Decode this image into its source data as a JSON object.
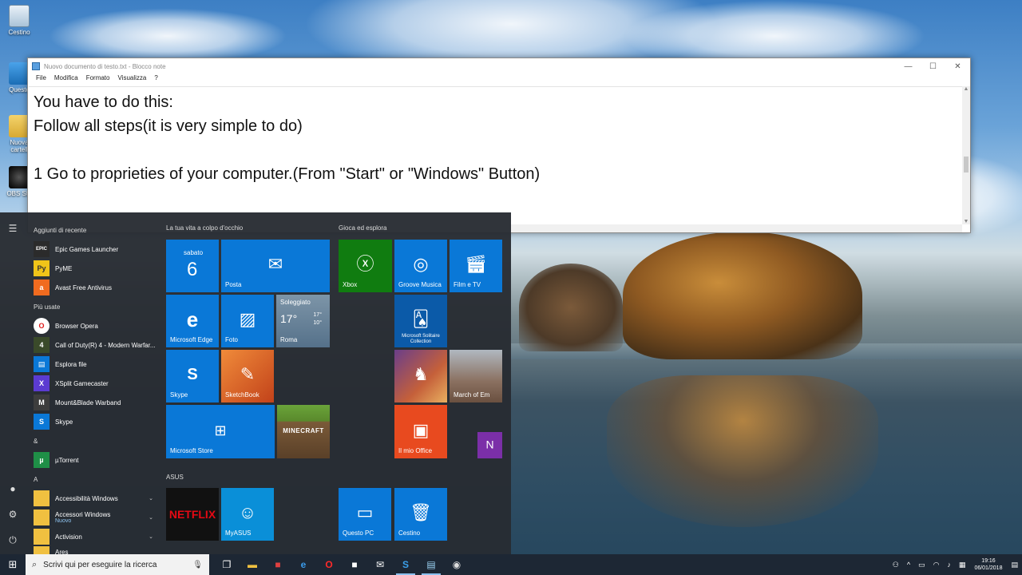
{
  "desktop": {
    "icons": [
      {
        "label": "Cestino",
        "icon": "recycle-bin-icon"
      },
      {
        "label": "Questo",
        "icon": "this-pc-icon"
      },
      {
        "label": "Nuova cartell",
        "icon": "folder-icon"
      },
      {
        "label": "OBS Stu",
        "icon": "obs-icon"
      }
    ]
  },
  "notepad": {
    "title": "Nuovo documento di testo.txt - Blocco note",
    "menu": [
      "File",
      "Modifica",
      "Formato",
      "Visualizza",
      "?"
    ],
    "controls": {
      "minimize": "—",
      "maximize": "☐",
      "close": "✕"
    },
    "content": "You have to do this:\nFollow all steps(it is very simple to do)\n\n1 Go to proprieties of your computer.(From \"Start\" or \"Windows\" Button)"
  },
  "start_menu": {
    "recent_header": "Aggiunti di recente",
    "recent": [
      {
        "label": "Epic Games Launcher",
        "icon": "epic-icon",
        "color": "#2b2b2b",
        "glyph": "EPIC"
      },
      {
        "label": "PyME",
        "icon": "pyme-icon",
        "color": "#f0c419",
        "glyph": "Py"
      },
      {
        "label": "Avast Free Antivirus",
        "icon": "avast-icon",
        "color": "#f06b1f",
        "glyph": "a"
      }
    ],
    "most_used_header": "Più usate",
    "most_used": [
      {
        "label": "Browser Opera",
        "icon": "opera-icon",
        "color": "#ffffff",
        "glyph": "O"
      },
      {
        "label": "Call of Duty(R) 4 - Modern Warfar...",
        "icon": "cod-icon",
        "color": "#3a4a2a",
        "glyph": "4"
      },
      {
        "label": "Esplora file",
        "icon": "file-explorer-icon",
        "color": "#0a78d7",
        "glyph": "▤"
      },
      {
        "label": "XSplit Gamecaster",
        "icon": "xsplit-icon",
        "color": "#5b3bd1",
        "glyph": "X"
      },
      {
        "label": "Mount&Blade Warband",
        "icon": "mountblade-icon",
        "color": "#3d3d3d",
        "glyph": "M"
      },
      {
        "label": "Skype",
        "icon": "skype-icon",
        "color": "#0a78d7",
        "glyph": "S"
      }
    ],
    "amp_header": "&",
    "amp_apps": [
      {
        "label": "µTorrent",
        "icon": "utorrent-icon",
        "color": "#1f8f47",
        "glyph": "µ"
      }
    ],
    "a_header": "A",
    "a_apps": [
      {
        "label": "Accessibilità Windows",
        "icon": "folder-icon",
        "color": "#f0c040",
        "glyph": "",
        "chevron": "⌄",
        "sub": ""
      },
      {
        "label": "Accessori Windows",
        "icon": "folder-icon",
        "color": "#f0c040",
        "glyph": "",
        "chevron": "⌄",
        "sub": "Nuovo"
      },
      {
        "label": "Activision",
        "icon": "folder-icon",
        "color": "#f0c040",
        "glyph": "",
        "chevron": "⌄",
        "sub": ""
      },
      {
        "label": "Ares",
        "icon": "folder-icon",
        "color": "#f0c040",
        "glyph": "",
        "chevron": "",
        "sub": ""
      }
    ],
    "groups": {
      "life": "La tua vita a colpo d'occhio",
      "play": "Gioca ed esplora",
      "asus": "ASUS"
    },
    "tiles": {
      "calendar_day": "sabato",
      "calendar_date": "6",
      "mail": "Posta",
      "edge": "Microsoft Edge",
      "photos": "Foto",
      "weather_cond": "Soleggiato",
      "weather_temp": "17°",
      "weather_hi": "17°",
      "weather_lo": "10°",
      "weather_city": "Roma",
      "skype": "Skype",
      "sketchbook": "SketchBook",
      "store": "Microsoft Store",
      "minecraft": "MINECRAFT",
      "xbox": "Xbox",
      "groove": "Groove Musica",
      "movies": "Film e TV",
      "solitaire": "Microsoft Solitaire Collection",
      "march": "March of Em",
      "office": "Il mio Office",
      "netflix": "NETFLIX",
      "myasus": "MyASUS",
      "this_pc": "Questo PC",
      "recycle": "Cestino"
    }
  },
  "taskbar": {
    "search_placeholder": "Scrivi qui per eseguire la ricerca",
    "apps": [
      {
        "icon": "task-view-icon",
        "glyph": "❐",
        "color": "#ffffff",
        "active": false
      },
      {
        "icon": "file-explorer-icon",
        "glyph": "▬",
        "color": "#f0c040",
        "active": false
      },
      {
        "icon": "gift-icon",
        "glyph": "■",
        "color": "#e04040",
        "active": false
      },
      {
        "icon": "edge-icon",
        "glyph": "e",
        "color": "#3b9bea",
        "active": false
      },
      {
        "icon": "opera-icon",
        "glyph": "O",
        "color": "#ff2a2a",
        "active": false
      },
      {
        "icon": "store-icon",
        "glyph": "■",
        "color": "#ffffff",
        "active": false
      },
      {
        "icon": "mail-icon",
        "glyph": "✉",
        "color": "#ffffff",
        "active": false
      },
      {
        "icon": "skype-icon",
        "glyph": "S",
        "color": "#3ba0ea",
        "active": true
      },
      {
        "icon": "notepad-icon",
        "glyph": "▤",
        "color": "#9ad0f0",
        "active": true
      },
      {
        "icon": "obs-icon",
        "glyph": "◉",
        "color": "#dddddd",
        "active": false
      }
    ],
    "time": "19:16",
    "date": "06/01/2018"
  }
}
